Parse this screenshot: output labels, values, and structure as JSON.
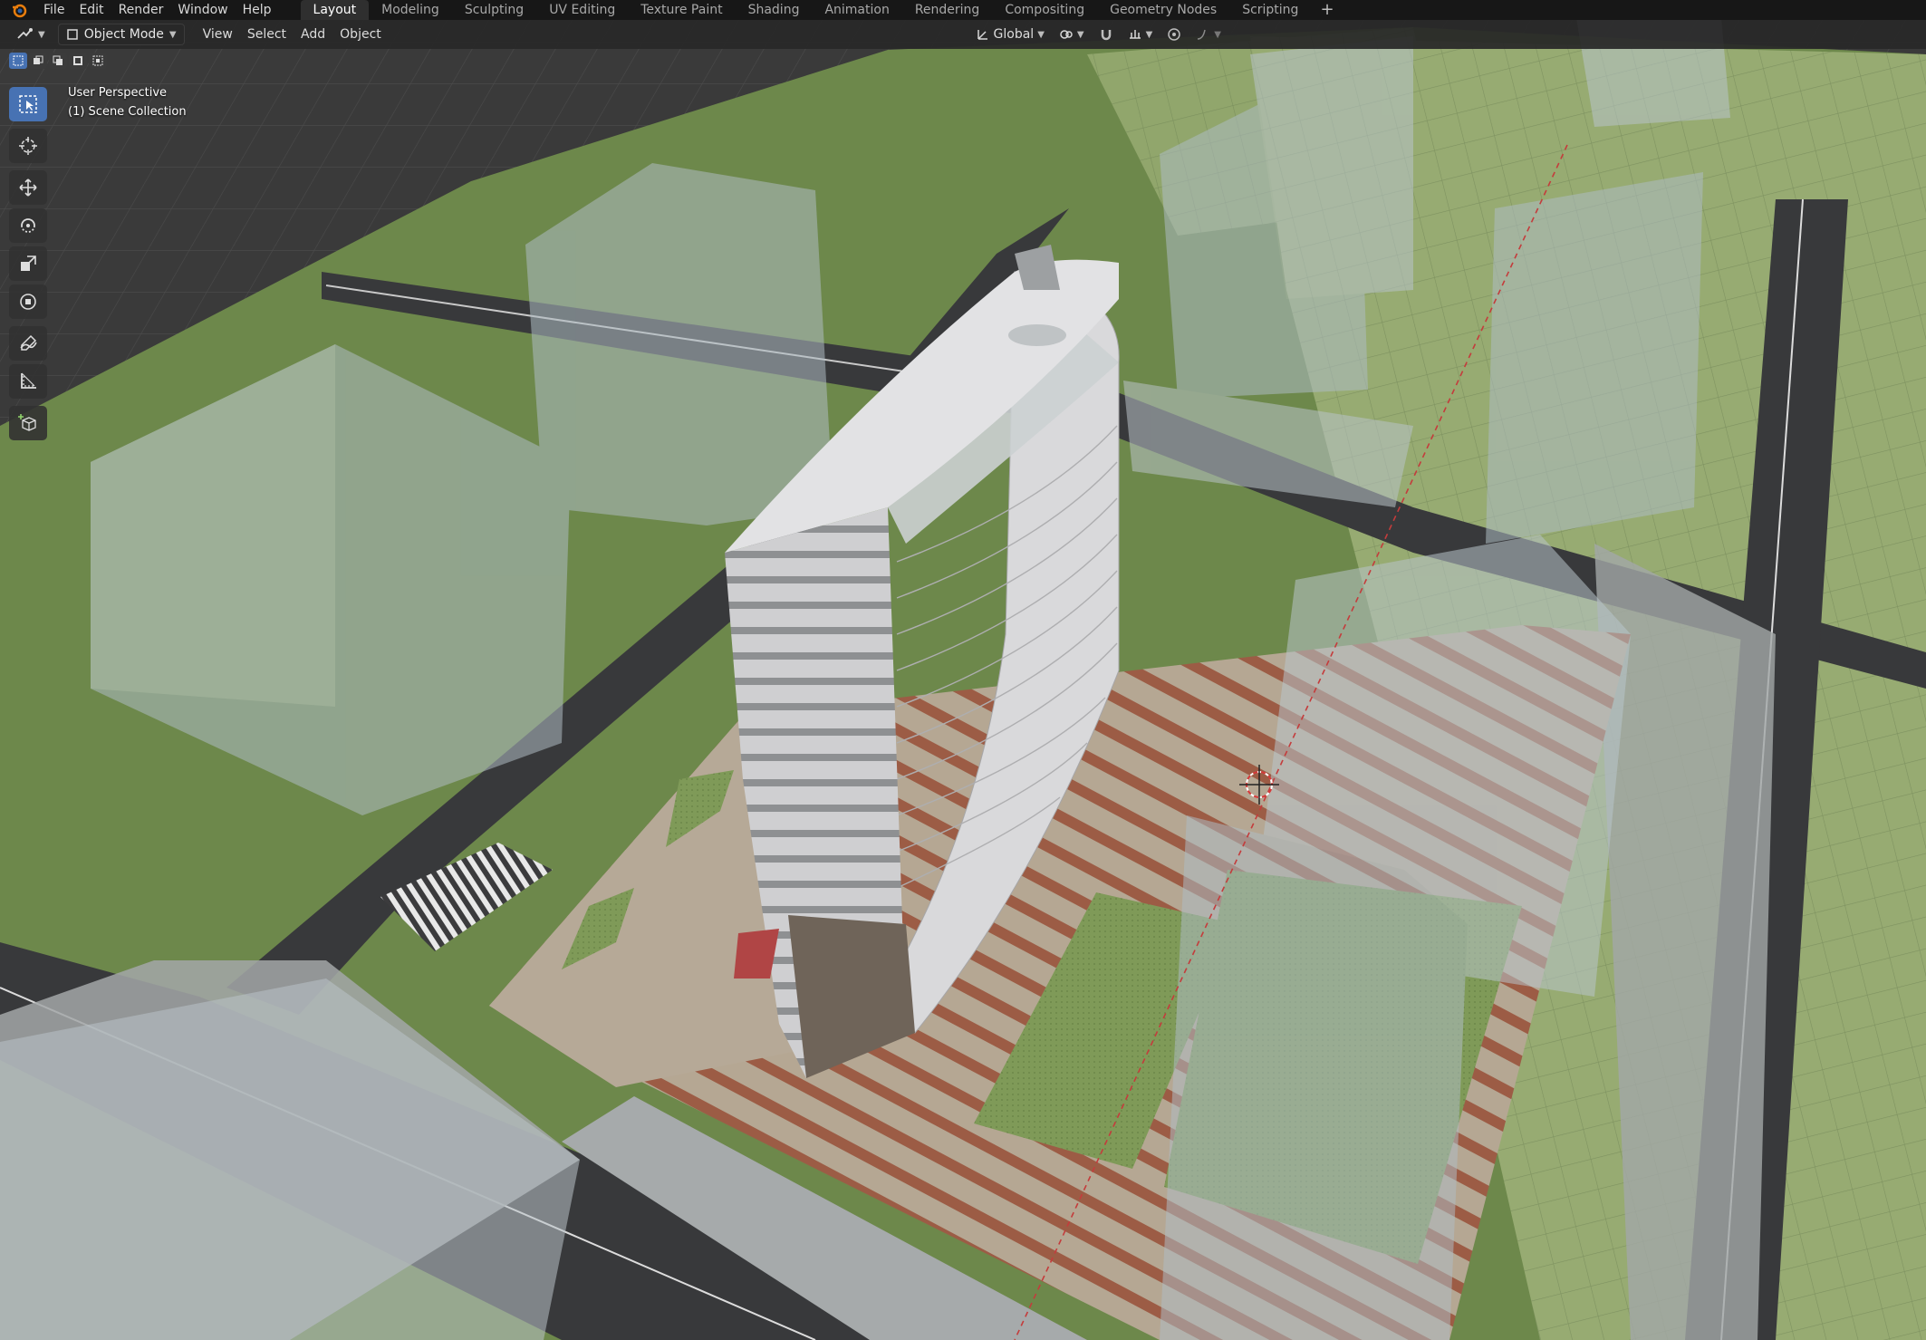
{
  "menus": [
    "File",
    "Edit",
    "Render",
    "Window",
    "Help"
  ],
  "workspace_tabs": [
    {
      "label": "Layout",
      "active": true
    },
    {
      "label": "Modeling",
      "active": false
    },
    {
      "label": "Sculpting",
      "active": false
    },
    {
      "label": "UV Editing",
      "active": false
    },
    {
      "label": "Texture Paint",
      "active": false
    },
    {
      "label": "Shading",
      "active": false
    },
    {
      "label": "Animation",
      "active": false
    },
    {
      "label": "Rendering",
      "active": false
    },
    {
      "label": "Compositing",
      "active": false
    },
    {
      "label": "Geometry Nodes",
      "active": false
    },
    {
      "label": "Scripting",
      "active": false
    }
  ],
  "header": {
    "mode": "Object Mode",
    "view_menu": "View",
    "select_menu": "Select",
    "add_menu": "Add",
    "object_menu": "Object",
    "orientation": "Global"
  },
  "viewport": {
    "perspective_label": "User Perspective",
    "collection_label": "(1) Scene Collection"
  },
  "tools": [
    {
      "icon": "select-box-icon",
      "active": true
    },
    {
      "icon": "cursor-icon",
      "active": false
    },
    {
      "icon": "move-icon",
      "active": false
    },
    {
      "icon": "rotate-icon",
      "active": false
    },
    {
      "icon": "scale-icon",
      "active": false
    },
    {
      "icon": "transform-icon",
      "active": false
    },
    {
      "icon": "annotate-icon",
      "active": false
    },
    {
      "icon": "measure-icon",
      "active": false
    },
    {
      "icon": "add-cube-icon",
      "active": false
    }
  ],
  "colors": {
    "accent": "#4772b3",
    "topbar": "#171717",
    "grass": "#6f8a4e",
    "road": "#3b3b3d",
    "sidewalk": "#a3a7a8",
    "plaza": "#b3a491",
    "brick": "#9a5a45",
    "building": "#d8d8da",
    "glass_block": "#a9b6bd"
  }
}
